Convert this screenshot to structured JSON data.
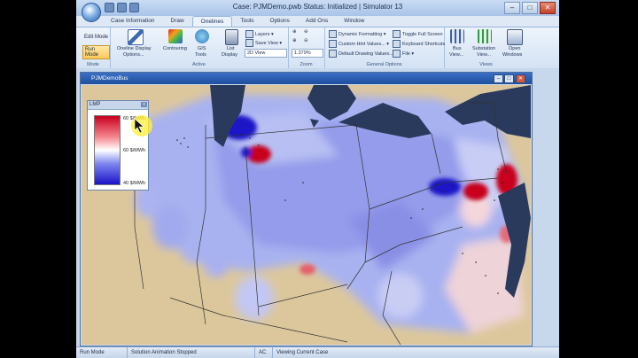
{
  "titlebar": {
    "title": "Case: PJMDemo.pwb  Status: Initialized | Simulator 13"
  },
  "window_controls": {
    "minimize": "–",
    "maximize": "□",
    "close": "✕"
  },
  "tabs": [
    "Case Information",
    "Draw",
    "Onelines",
    "Tools",
    "Options",
    "Add Ons",
    "Window"
  ],
  "active_tab": "Onelines",
  "ribbon": {
    "mode": {
      "edit": "Edit Mode",
      "run": "Run Mode",
      "label": "Mode"
    },
    "active": {
      "oneline_display": "Oneline Display",
      "options": "Options...",
      "contouring": "Contouring",
      "gis": "GIS",
      "gis_tools": "Tools",
      "list": "List",
      "list_display": "Display",
      "layers": "Layers",
      "save_view": "Save View",
      "view_mode": "2D View",
      "label": "Active"
    },
    "zoom": {
      "value": "1.379%",
      "label": "Zoom"
    },
    "general": {
      "dynamic_formatting": "Dynamic Formatting",
      "custom_hint": "Custom Hint Values...",
      "default_drawing": "Default Drawing Values...",
      "toggle_full_screen": "Toggle Full Screen",
      "keyboard_shortcuts": "Keyboard Shortcuts",
      "file": "File",
      "label": "General Options"
    },
    "views": {
      "bus": "Bus",
      "bus_sub": "View...",
      "substation": "Substation",
      "substation_sub": "View...",
      "open": "Open",
      "open_sub": "Windows",
      "label": "Views"
    }
  },
  "child_window": {
    "title": "PJMDemoBus",
    "minimize": "–",
    "maximize": "□",
    "close": "✕"
  },
  "legend": {
    "title": "LMP",
    "close": "x",
    "max_label": "60 $/MWh",
    "mid_label": "60 $/MWh",
    "min_label": "40 $/MWh"
  },
  "statusbar": {
    "mode": "Run Mode",
    "animation": "Solution Animation Stopped",
    "power": "AC",
    "case_view": "Viewing Current Case"
  },
  "colors": {
    "land": "#dcc79c",
    "water": "#2a3a5c",
    "lmp_high": "#c8001e",
    "lmp_low": "#1a14c8"
  }
}
